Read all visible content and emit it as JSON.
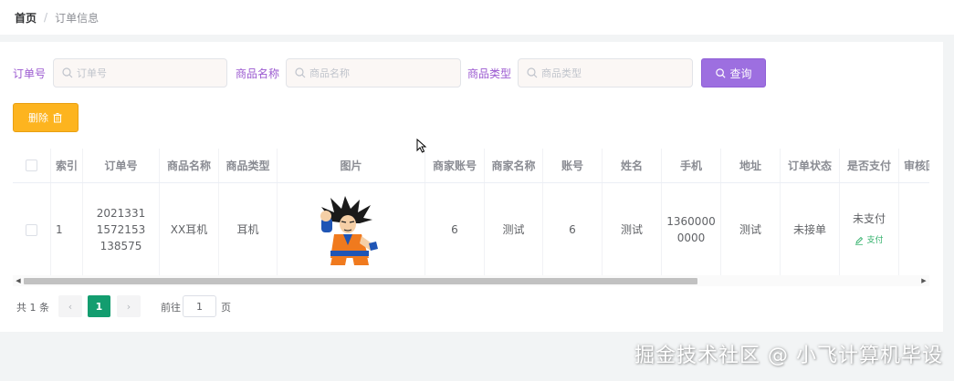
{
  "breadcrumb": {
    "home": "首页",
    "separator": "/",
    "current": "订单信息"
  },
  "search": {
    "order_no": {
      "label": "订单号",
      "placeholder": "订单号"
    },
    "product_name": {
      "label": "商品名称",
      "placeholder": "商品名称"
    },
    "product_type": {
      "label": "商品类型",
      "placeholder": "商品类型"
    },
    "button_label": "查询"
  },
  "toolbar": {
    "delete_label": "删除"
  },
  "table": {
    "columns": [
      "索引",
      "订单号",
      "商品名称",
      "商品类型",
      "图片",
      "商家账号",
      "商家名称",
      "账号",
      "姓名",
      "手机",
      "地址",
      "订单状态",
      "是否支付",
      "审核回复"
    ],
    "rows": [
      {
        "index": "1",
        "order_no": "20213311572153138575",
        "order_no_lines": [
          "2021331",
          "1572153",
          "138575"
        ],
        "product_name": "XX耳机",
        "product_type": "耳机",
        "image": "goku-character-image",
        "merchant_account": "6",
        "merchant_name": "测试",
        "account": "6",
        "name": "测试",
        "phone": "13600000000",
        "phone_lines": [
          "1360000",
          "0000"
        ],
        "address": "测试",
        "order_status": "未接单",
        "paid": "未支付",
        "pay_action": "支付"
      }
    ]
  },
  "pagination": {
    "total": "共 1 条",
    "current_page": "1",
    "goto_label": "前往",
    "goto_value": "1",
    "page_unit": "页"
  },
  "watermark": "掘金技术社区 @ 小飞计算机毕设",
  "colors": {
    "label_purple": "#9b59d0",
    "search_button": "#9d6fe0",
    "delete_button": "#fdb41f",
    "pager_active": "#139d6f",
    "pay_link": "#31b06a"
  }
}
